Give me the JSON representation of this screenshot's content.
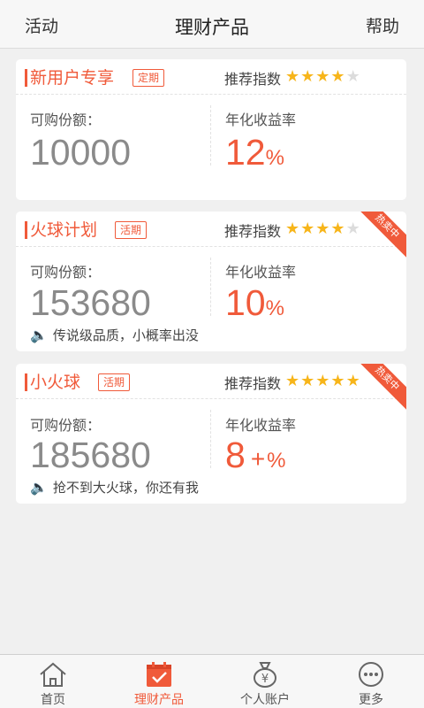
{
  "header": {
    "left_label": "活动",
    "title": "理财产品",
    "right_label": "帮助"
  },
  "colors": {
    "accent": "#f05a3a",
    "star": "#f7b51a",
    "star_empty": "#dcdcdc"
  },
  "products": [
    {
      "name": "新用户专享",
      "tag": "定期",
      "recommend_label": "推荐指数",
      "rating": 4,
      "rating_max": 5,
      "amount_label": "可购份额：",
      "amount": "10000",
      "rate_label": "年化收益率",
      "rate_value": "12",
      "rate_unit": "%"
    },
    {
      "name": "火球计划",
      "tag": "活期",
      "recommend_label": "推荐指数",
      "rating": 4,
      "rating_max": 5,
      "ribbon": "热卖中",
      "amount_label": "可购份额：",
      "amount": "153680",
      "rate_label": "年化收益率",
      "rate_value": "10",
      "rate_unit": "%",
      "note": "传说级品质，小概率出没"
    },
    {
      "name": "小火球",
      "tag": "活期",
      "recommend_label": "推荐指数",
      "rating": 5,
      "rating_max": 5,
      "ribbon": "热卖中",
      "amount_label": "可购份额：",
      "amount": "185680",
      "rate_label": "年化收益率",
      "rate_value": "8",
      "rate_plus": "+",
      "rate_unit": "%",
      "note": "抢不到大火球，你还有我"
    }
  ],
  "tabbar": {
    "items": [
      {
        "label": "首页",
        "icon": "home-icon"
      },
      {
        "label": "理财产品",
        "icon": "calendar-check-icon",
        "active": true
      },
      {
        "label": "个人账户",
        "icon": "money-bag-icon"
      },
      {
        "label": "更多",
        "icon": "more-dots-icon"
      }
    ]
  }
}
